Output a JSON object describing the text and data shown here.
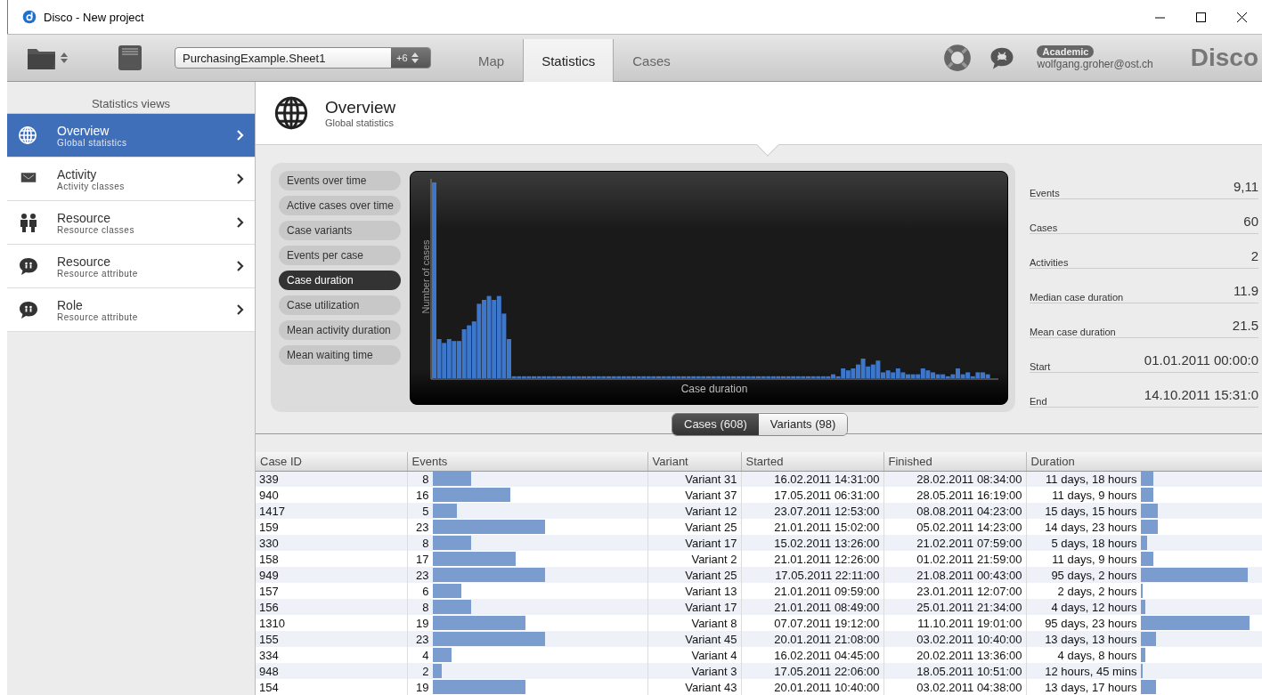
{
  "window": {
    "title": "Disco - New project"
  },
  "toolbar": {
    "dataset": "PurchasingExample.Sheet1",
    "dataset_badge": "+6",
    "tabs": [
      {
        "label": "Map",
        "selected": false
      },
      {
        "label": "Statistics",
        "selected": true
      },
      {
        "label": "Cases",
        "selected": false
      }
    ],
    "license": "Academic",
    "user": "wolfgang.groher@ost.ch",
    "logo": "Disco"
  },
  "sidebar": {
    "title": "Statistics views",
    "items": [
      {
        "kind": "globe",
        "title": "Overview",
        "subtitle": "Global statistics",
        "selected": true
      },
      {
        "kind": "envelope",
        "title": "Activity",
        "subtitle": "Activity classes",
        "selected": false
      },
      {
        "kind": "people",
        "title": "Resource",
        "subtitle": "Resource classes",
        "selected": false
      },
      {
        "kind": "bubble",
        "title": "Resource",
        "subtitle": "Resource attribute",
        "selected": false
      },
      {
        "kind": "bubble",
        "title": "Role",
        "subtitle": "Resource attribute",
        "selected": false
      }
    ]
  },
  "header": {
    "title": "Overview",
    "subtitle": "Global statistics"
  },
  "views": [
    {
      "label": "Events over time",
      "selected": false
    },
    {
      "label": "Active cases over time",
      "selected": false
    },
    {
      "label": "Case variants",
      "selected": false
    },
    {
      "label": "Events per case",
      "selected": false
    },
    {
      "label": "Case duration",
      "selected": true
    },
    {
      "label": "Case utilization",
      "selected": false
    },
    {
      "label": "Mean activity duration",
      "selected": false
    },
    {
      "label": "Mean waiting time",
      "selected": false
    }
  ],
  "chart": {
    "ylabel": "Number of cases",
    "xlabel": "Case duration"
  },
  "stats": [
    {
      "label": "Events",
      "value": "9,11"
    },
    {
      "label": "Cases",
      "value": "60"
    },
    {
      "label": "Activities",
      "value": "2"
    },
    {
      "label": "Median case duration",
      "value": "11.9"
    },
    {
      "label": "Mean case duration",
      "value": "21.5"
    },
    {
      "label": "Start",
      "value": "01.01.2011 00:00:0"
    },
    {
      "label": "End",
      "value": "14.10.2011 15:31:0"
    }
  ],
  "list_tabs": [
    {
      "label": "Cases (608)",
      "selected": true
    },
    {
      "label": "Variants (98)",
      "selected": false
    }
  ],
  "table": {
    "columns": [
      "Case ID",
      "Events",
      "Variant",
      "Started",
      "Finished",
      "Duration"
    ],
    "rows": [
      {
        "case_id": "339",
        "events": "8",
        "variant": "Variant 31",
        "started": "16.02.2011 14:31:00",
        "finished": "28.02.2011 08:34:00",
        "duration": "11 days, 18 hours"
      },
      {
        "case_id": "940",
        "events": "16",
        "variant": "Variant 37",
        "started": "17.05.2011 06:31:00",
        "finished": "28.05.2011 16:19:00",
        "duration": "11 days, 9 hours"
      },
      {
        "case_id": "1417",
        "events": "5",
        "variant": "Variant 12",
        "started": "23.07.2011 12:53:00",
        "finished": "08.08.2011 04:23:00",
        "duration": "15 days, 15 hours"
      },
      {
        "case_id": "159",
        "events": "23",
        "variant": "Variant 25",
        "started": "21.01.2011 15:02:00",
        "finished": "05.02.2011 14:23:00",
        "duration": "14 days, 23 hours"
      },
      {
        "case_id": "330",
        "events": "8",
        "variant": "Variant 17",
        "started": "15.02.2011 13:26:00",
        "finished": "21.02.2011 07:59:00",
        "duration": "5 days, 18 hours"
      },
      {
        "case_id": "158",
        "events": "17",
        "variant": "Variant 2",
        "started": "21.01.2011 12:26:00",
        "finished": "01.02.2011 21:59:00",
        "duration": "11 days, 9 hours"
      },
      {
        "case_id": "949",
        "events": "23",
        "variant": "Variant 25",
        "started": "17.05.2011 22:11:00",
        "finished": "21.08.2011 00:43:00",
        "duration": "95 days, 2 hours"
      },
      {
        "case_id": "157",
        "events": "6",
        "variant": "Variant 13",
        "started": "21.01.2011 09:59:00",
        "finished": "23.01.2011 12:07:00",
        "duration": "2 days, 2 hours"
      },
      {
        "case_id": "156",
        "events": "8",
        "variant": "Variant 17",
        "started": "21.01.2011 08:49:00",
        "finished": "25.01.2011 21:34:00",
        "duration": "4 days, 12 hours"
      },
      {
        "case_id": "1310",
        "events": "19",
        "variant": "Variant 8",
        "started": "07.07.2011 19:12:00",
        "finished": "11.10.2011 19:01:00",
        "duration": "95 days, 23 hours"
      },
      {
        "case_id": "155",
        "events": "23",
        "variant": "Variant 45",
        "started": "20.01.2011 21:08:00",
        "finished": "03.02.2011 10:40:00",
        "duration": "13 days, 13 hours"
      },
      {
        "case_id": "334",
        "events": "4",
        "variant": "Variant 4",
        "started": "16.02.2011 04:45:00",
        "finished": "20.02.2011 13:36:00",
        "duration": "4 days, 8 hours"
      },
      {
        "case_id": "948",
        "events": "2",
        "variant": "Variant 3",
        "started": "17.05.2011 22:06:00",
        "finished": "18.05.2011 10:51:00",
        "duration": "12 hours, 45 mins"
      },
      {
        "case_id": "154",
        "events": "19",
        "variant": "Variant 43",
        "started": "20.01.2011 10:40:00",
        "finished": "03.02.2011 04:38:00",
        "duration": "13 days, 17 hours"
      }
    ]
  }
}
